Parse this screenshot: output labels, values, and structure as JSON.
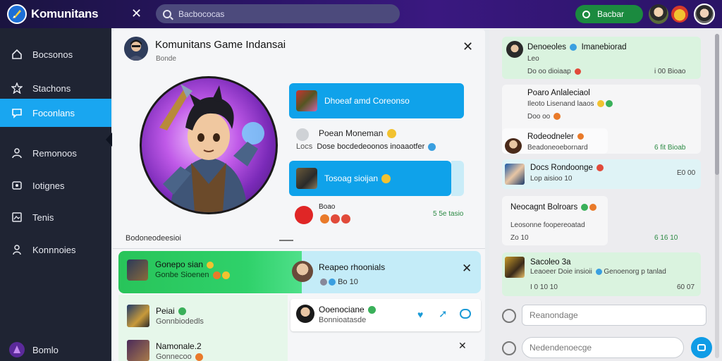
{
  "app": {
    "name": "Komunitans",
    "search_placeholder": "Bacbococas",
    "top_button": "Bacbar"
  },
  "sidebar": {
    "items": [
      {
        "label": "Bocsonos",
        "icon": "home-icon"
      },
      {
        "label": "Stachons",
        "icon": "star-icon"
      },
      {
        "label": "Foconlans",
        "icon": "chat-icon",
        "active": true
      },
      {
        "label": "Remonoos",
        "icon": "user-icon"
      },
      {
        "label": "Iotignes",
        "icon": "message-icon"
      },
      {
        "label": "Tenis",
        "icon": "image-icon"
      },
      {
        "label": "Konnnoies",
        "icon": "people-icon"
      },
      {
        "label": "Bomlo",
        "icon": "profile-icon"
      }
    ]
  },
  "main": {
    "title": "Komunitans Game Indansai",
    "subtitle": "Bonde",
    "messages": [
      {
        "text": "Dhoeaf amd Coreonso"
      },
      {
        "name": "Poean Moneman",
        "text": "Dose bocdedeoonos inoaaotfer"
      },
      {
        "text": "Tosoag sioijan"
      },
      {
        "name": "Boao",
        "time": "5 5e tasio"
      }
    ],
    "section_label": "Bodoneodeesioi",
    "list": [
      {
        "name": "Gonepo sian",
        "sub": "Gonbe Sioenen"
      },
      {
        "name": "Reapeo rhoonials",
        "sub": "Bo 10"
      },
      {
        "name": "Peiai",
        "sub": "Gonnbiodedls"
      },
      {
        "name": "Ooenociane",
        "sub": "Bonnioatasde"
      },
      {
        "name": "Namonale.2",
        "sub": "Gonnecoo"
      }
    ]
  },
  "right": {
    "messages": [
      {
        "name": "Denoeoles",
        "extra": "Imanebiorad",
        "body": "Leo",
        "meta": "Do oo dioiaap",
        "time": "i 00 Bioao",
        "style": "green"
      },
      {
        "name": "Poaro Anlaleciaol",
        "body": "Ileoto Lisenand laaos",
        "meta": "Doo oo",
        "style": "gray"
      },
      {
        "name": "Rodeodneler",
        "body": "Beadoneoebornard",
        "time": "6 fit Bioab",
        "style": "gray"
      },
      {
        "name": "Docs Rondoonge",
        "body": "Lop aisioo 10",
        "time": "E0 00",
        "style": "green"
      },
      {
        "name": "Neocagnt Bolroars",
        "body": "Leosonne foopereoatad",
        "meta": "Zo 10",
        "time": "6 16 10",
        "style": "gray"
      },
      {
        "name": "Sacoleo 3a",
        "body": "Leaoeer Doie insioii",
        "extra": "Genoenorg p tanlad",
        "meta": "I 0 10 10",
        "time": "60 07",
        "style": "green"
      }
    ],
    "input_placeholder": "Reanondage",
    "input2_placeholder": "Nedendenoecge"
  }
}
